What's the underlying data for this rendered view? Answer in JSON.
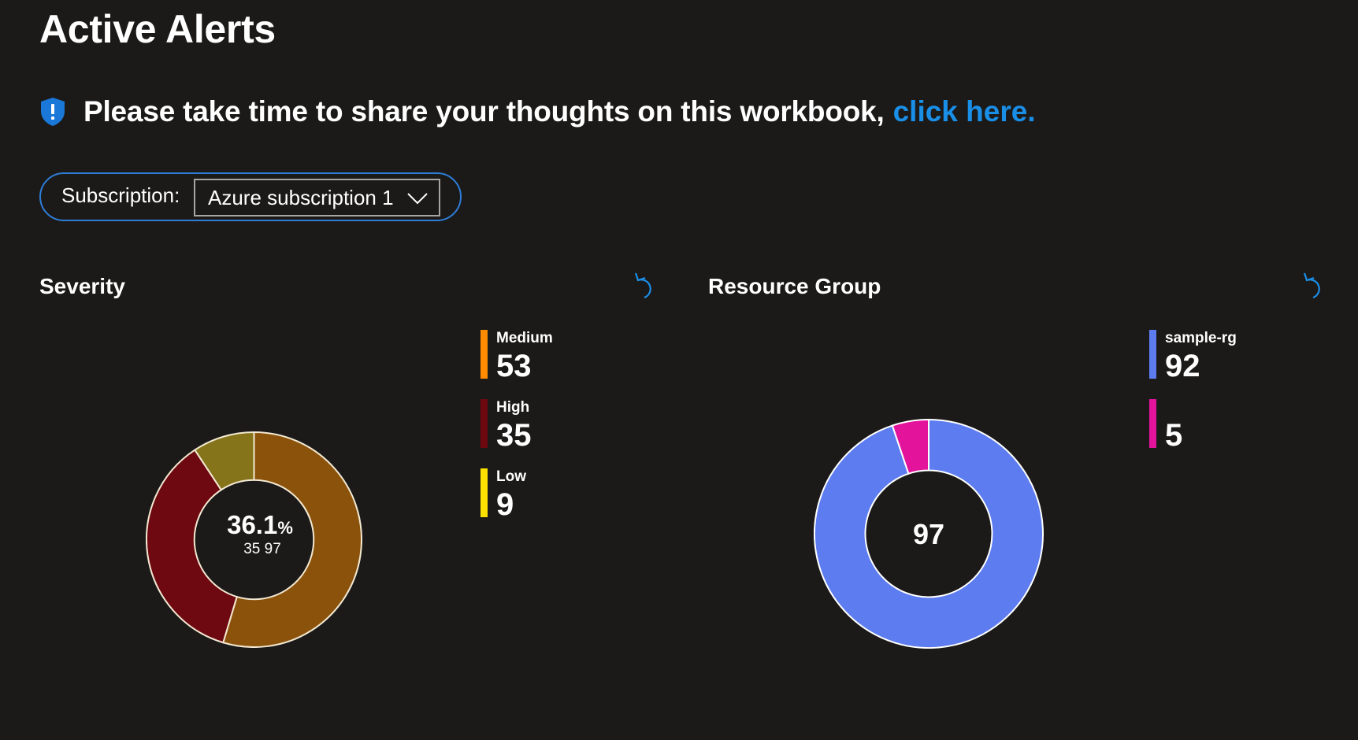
{
  "page": {
    "title": "Active Alerts"
  },
  "feedback": {
    "icon": "shield-info-icon",
    "text": "Please take time to share your thoughts on this workbook,",
    "link_text": "click here.",
    "link_color": "#1a8fe8"
  },
  "parameters": {
    "subscription": {
      "label": "Subscription:",
      "selected": "Azure subscription 1",
      "icon": "chevron-down-icon"
    }
  },
  "colors": {
    "background": "#1b1a19",
    "pill_border": "#2e7dd7",
    "refresh_icon": "#1a8fe8"
  },
  "severity": {
    "title": "Severity",
    "refresh_icon": "refresh-icon",
    "legend": [
      {
        "name": "Medium",
        "value": "53",
        "color": "#ff8c00"
      },
      {
        "name": "High",
        "value": "35",
        "color": "#6e0811"
      },
      {
        "name": "Low",
        "value": "9",
        "color": "#fce100"
      }
    ],
    "center": {
      "percent": "36.1",
      "percent_sign": "%",
      "value": "35",
      "total": "97"
    },
    "chart_data": {
      "type": "pie",
      "labels": [
        "Medium",
        "High",
        "Low"
      ],
      "values": [
        53,
        35,
        9
      ],
      "colors": [
        "#8b520b",
        "#6e0811",
        "#85741a"
      ],
      "donut": true
    }
  },
  "resource_group": {
    "title": "Resource Group",
    "refresh_icon": "refresh-icon",
    "legend": [
      {
        "name": "sample-rg",
        "value": "92",
        "color": "#5c7cf0"
      },
      {
        "name": "",
        "value": "5",
        "color": "#e3139b"
      }
    ],
    "center": {
      "total": "97"
    },
    "chart_data": {
      "type": "pie",
      "labels": [
        "sample-rg",
        ""
      ],
      "values": [
        92,
        5
      ],
      "colors": [
        "#5c7cf0",
        "#e3139b"
      ],
      "donut": true
    }
  }
}
